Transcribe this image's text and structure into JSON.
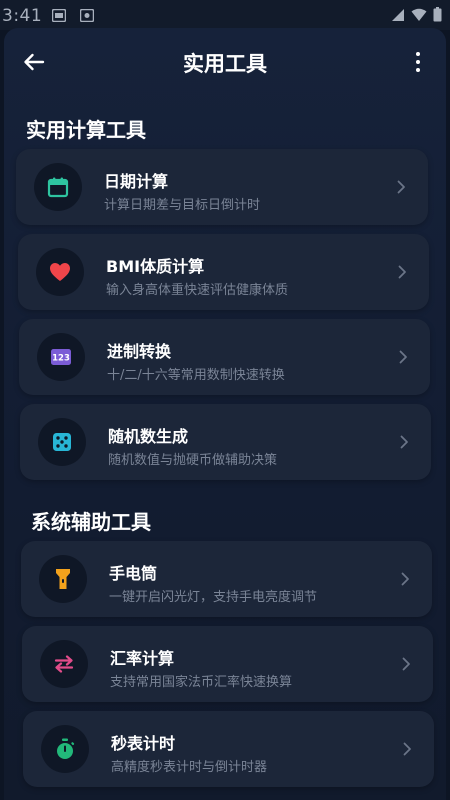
{
  "status_bar": {
    "time": "3:41"
  },
  "header": {
    "title": "实用工具"
  },
  "sections": [
    {
      "title": "实用计算工具",
      "items": [
        {
          "title": "日期计算",
          "subtitle": "计算日期差与目标日倒计时",
          "icon": "calendar-icon",
          "color": "#2ec4a0"
        },
        {
          "title": "BMI体质计算",
          "subtitle": "输入身高体重快速评估健康体质",
          "icon": "heart-icon",
          "color": "#f0454a"
        },
        {
          "title": "进制转换",
          "subtitle": "十/二/十六等常用数制快速转换",
          "icon": "number-123-icon",
          "color": "#7b5cd6"
        },
        {
          "title": "随机数生成",
          "subtitle": "随机数值与抛硬币做辅助决策",
          "icon": "dice-icon",
          "color": "#28b6d6"
        }
      ]
    },
    {
      "title": "系统辅助工具",
      "items": [
        {
          "title": "手电筒",
          "subtitle": "一键开启闪光灯，支持手电亮度调节",
          "icon": "flashlight-icon",
          "color": "#f3a21c"
        },
        {
          "title": "汇率计算",
          "subtitle": "支持常用国家法币汇率快速换算",
          "icon": "exchange-arrows-icon",
          "color": "#e24c8a"
        },
        {
          "title": "秒表计时",
          "subtitle": "高精度秒表计时与倒计时器",
          "icon": "stopwatch-icon",
          "color": "#22b87a"
        }
      ]
    }
  ]
}
